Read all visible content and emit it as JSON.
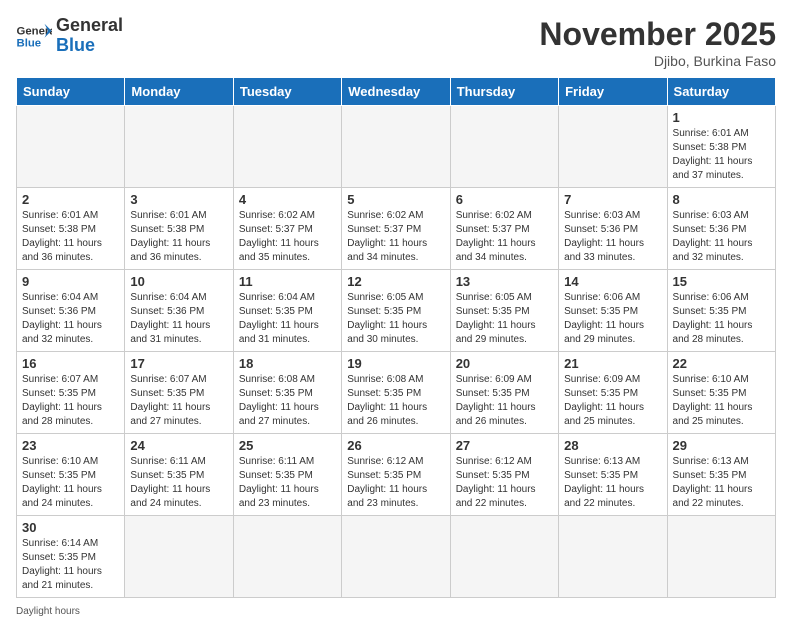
{
  "header": {
    "logo_general": "General",
    "logo_blue": "Blue",
    "month_year": "November 2025",
    "location": "Djibo, Burkina Faso"
  },
  "days_of_week": [
    "Sunday",
    "Monday",
    "Tuesday",
    "Wednesday",
    "Thursday",
    "Friday",
    "Saturday"
  ],
  "weeks": [
    [
      {
        "day": "",
        "sunrise": "",
        "sunset": "",
        "daylight": "",
        "empty": true
      },
      {
        "day": "",
        "sunrise": "",
        "sunset": "",
        "daylight": "",
        "empty": true
      },
      {
        "day": "",
        "sunrise": "",
        "sunset": "",
        "daylight": "",
        "empty": true
      },
      {
        "day": "",
        "sunrise": "",
        "sunset": "",
        "daylight": "",
        "empty": true
      },
      {
        "day": "",
        "sunrise": "",
        "sunset": "",
        "daylight": "",
        "empty": true
      },
      {
        "day": "",
        "sunrise": "",
        "sunset": "",
        "daylight": "",
        "empty": true
      },
      {
        "day": "1",
        "sunrise": "Sunrise: 6:01 AM",
        "sunset": "Sunset: 5:38 PM",
        "daylight": "Daylight: 11 hours and 37 minutes.",
        "empty": false
      }
    ],
    [
      {
        "day": "2",
        "sunrise": "Sunrise: 6:01 AM",
        "sunset": "Sunset: 5:38 PM",
        "daylight": "Daylight: 11 hours and 36 minutes.",
        "empty": false
      },
      {
        "day": "3",
        "sunrise": "Sunrise: 6:01 AM",
        "sunset": "Sunset: 5:38 PM",
        "daylight": "Daylight: 11 hours and 36 minutes.",
        "empty": false
      },
      {
        "day": "4",
        "sunrise": "Sunrise: 6:02 AM",
        "sunset": "Sunset: 5:37 PM",
        "daylight": "Daylight: 11 hours and 35 minutes.",
        "empty": false
      },
      {
        "day": "5",
        "sunrise": "Sunrise: 6:02 AM",
        "sunset": "Sunset: 5:37 PM",
        "daylight": "Daylight: 11 hours and 34 minutes.",
        "empty": false
      },
      {
        "day": "6",
        "sunrise": "Sunrise: 6:02 AM",
        "sunset": "Sunset: 5:37 PM",
        "daylight": "Daylight: 11 hours and 34 minutes.",
        "empty": false
      },
      {
        "day": "7",
        "sunrise": "Sunrise: 6:03 AM",
        "sunset": "Sunset: 5:36 PM",
        "daylight": "Daylight: 11 hours and 33 minutes.",
        "empty": false
      },
      {
        "day": "8",
        "sunrise": "Sunrise: 6:03 AM",
        "sunset": "Sunset: 5:36 PM",
        "daylight": "Daylight: 11 hours and 32 minutes.",
        "empty": false
      }
    ],
    [
      {
        "day": "9",
        "sunrise": "Sunrise: 6:04 AM",
        "sunset": "Sunset: 5:36 PM",
        "daylight": "Daylight: 11 hours and 32 minutes.",
        "empty": false
      },
      {
        "day": "10",
        "sunrise": "Sunrise: 6:04 AM",
        "sunset": "Sunset: 5:36 PM",
        "daylight": "Daylight: 11 hours and 31 minutes.",
        "empty": false
      },
      {
        "day": "11",
        "sunrise": "Sunrise: 6:04 AM",
        "sunset": "Sunset: 5:35 PM",
        "daylight": "Daylight: 11 hours and 31 minutes.",
        "empty": false
      },
      {
        "day": "12",
        "sunrise": "Sunrise: 6:05 AM",
        "sunset": "Sunset: 5:35 PM",
        "daylight": "Daylight: 11 hours and 30 minutes.",
        "empty": false
      },
      {
        "day": "13",
        "sunrise": "Sunrise: 6:05 AM",
        "sunset": "Sunset: 5:35 PM",
        "daylight": "Daylight: 11 hours and 29 minutes.",
        "empty": false
      },
      {
        "day": "14",
        "sunrise": "Sunrise: 6:06 AM",
        "sunset": "Sunset: 5:35 PM",
        "daylight": "Daylight: 11 hours and 29 minutes.",
        "empty": false
      },
      {
        "day": "15",
        "sunrise": "Sunrise: 6:06 AM",
        "sunset": "Sunset: 5:35 PM",
        "daylight": "Daylight: 11 hours and 28 minutes.",
        "empty": false
      }
    ],
    [
      {
        "day": "16",
        "sunrise": "Sunrise: 6:07 AM",
        "sunset": "Sunset: 5:35 PM",
        "daylight": "Daylight: 11 hours and 28 minutes.",
        "empty": false
      },
      {
        "day": "17",
        "sunrise": "Sunrise: 6:07 AM",
        "sunset": "Sunset: 5:35 PM",
        "daylight": "Daylight: 11 hours and 27 minutes.",
        "empty": false
      },
      {
        "day": "18",
        "sunrise": "Sunrise: 6:08 AM",
        "sunset": "Sunset: 5:35 PM",
        "daylight": "Daylight: 11 hours and 27 minutes.",
        "empty": false
      },
      {
        "day": "19",
        "sunrise": "Sunrise: 6:08 AM",
        "sunset": "Sunset: 5:35 PM",
        "daylight": "Daylight: 11 hours and 26 minutes.",
        "empty": false
      },
      {
        "day": "20",
        "sunrise": "Sunrise: 6:09 AM",
        "sunset": "Sunset: 5:35 PM",
        "daylight": "Daylight: 11 hours and 26 minutes.",
        "empty": false
      },
      {
        "day": "21",
        "sunrise": "Sunrise: 6:09 AM",
        "sunset": "Sunset: 5:35 PM",
        "daylight": "Daylight: 11 hours and 25 minutes.",
        "empty": false
      },
      {
        "day": "22",
        "sunrise": "Sunrise: 6:10 AM",
        "sunset": "Sunset: 5:35 PM",
        "daylight": "Daylight: 11 hours and 25 minutes.",
        "empty": false
      }
    ],
    [
      {
        "day": "23",
        "sunrise": "Sunrise: 6:10 AM",
        "sunset": "Sunset: 5:35 PM",
        "daylight": "Daylight: 11 hours and 24 minutes.",
        "empty": false
      },
      {
        "day": "24",
        "sunrise": "Sunrise: 6:11 AM",
        "sunset": "Sunset: 5:35 PM",
        "daylight": "Daylight: 11 hours and 24 minutes.",
        "empty": false
      },
      {
        "day": "25",
        "sunrise": "Sunrise: 6:11 AM",
        "sunset": "Sunset: 5:35 PM",
        "daylight": "Daylight: 11 hours and 23 minutes.",
        "empty": false
      },
      {
        "day": "26",
        "sunrise": "Sunrise: 6:12 AM",
        "sunset": "Sunset: 5:35 PM",
        "daylight": "Daylight: 11 hours and 23 minutes.",
        "empty": false
      },
      {
        "day": "27",
        "sunrise": "Sunrise: 6:12 AM",
        "sunset": "Sunset: 5:35 PM",
        "daylight": "Daylight: 11 hours and 22 minutes.",
        "empty": false
      },
      {
        "day": "28",
        "sunrise": "Sunrise: 6:13 AM",
        "sunset": "Sunset: 5:35 PM",
        "daylight": "Daylight: 11 hours and 22 minutes.",
        "empty": false
      },
      {
        "day": "29",
        "sunrise": "Sunrise: 6:13 AM",
        "sunset": "Sunset: 5:35 PM",
        "daylight": "Daylight: 11 hours and 22 minutes.",
        "empty": false
      }
    ],
    [
      {
        "day": "30",
        "sunrise": "Sunrise: 6:14 AM",
        "sunset": "Sunset: 5:35 PM",
        "daylight": "Daylight: 11 hours and 21 minutes.",
        "empty": false
      },
      {
        "day": "",
        "sunrise": "",
        "sunset": "",
        "daylight": "",
        "empty": true
      },
      {
        "day": "",
        "sunrise": "",
        "sunset": "",
        "daylight": "",
        "empty": true
      },
      {
        "day": "",
        "sunrise": "",
        "sunset": "",
        "daylight": "",
        "empty": true
      },
      {
        "day": "",
        "sunrise": "",
        "sunset": "",
        "daylight": "",
        "empty": true
      },
      {
        "day": "",
        "sunrise": "",
        "sunset": "",
        "daylight": "",
        "empty": true
      },
      {
        "day": "",
        "sunrise": "",
        "sunset": "",
        "daylight": "",
        "empty": true
      }
    ]
  ],
  "footer": {
    "daylight_label": "Daylight hours"
  }
}
